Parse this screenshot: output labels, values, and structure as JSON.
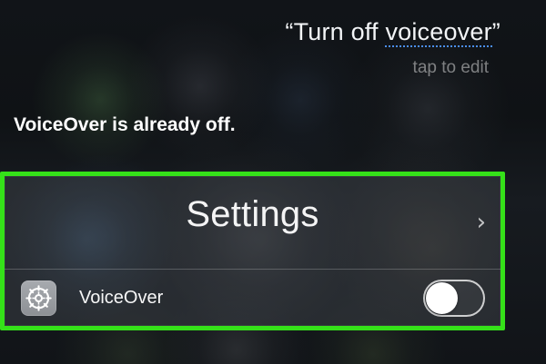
{
  "siri": {
    "transcript_prefix": "“Turn off ",
    "transcript_keyword": "voiceover",
    "transcript_suffix": "”",
    "edit_hint": "tap to edit",
    "response": "VoiceOver is already off."
  },
  "settings_card": {
    "title": "Settings",
    "chevron_icon": "chevron-right-icon",
    "highlight_color": "#35e119",
    "row": {
      "icon": "settings-gear-icon",
      "label": "VoiceOver",
      "toggle_state": "off"
    }
  }
}
